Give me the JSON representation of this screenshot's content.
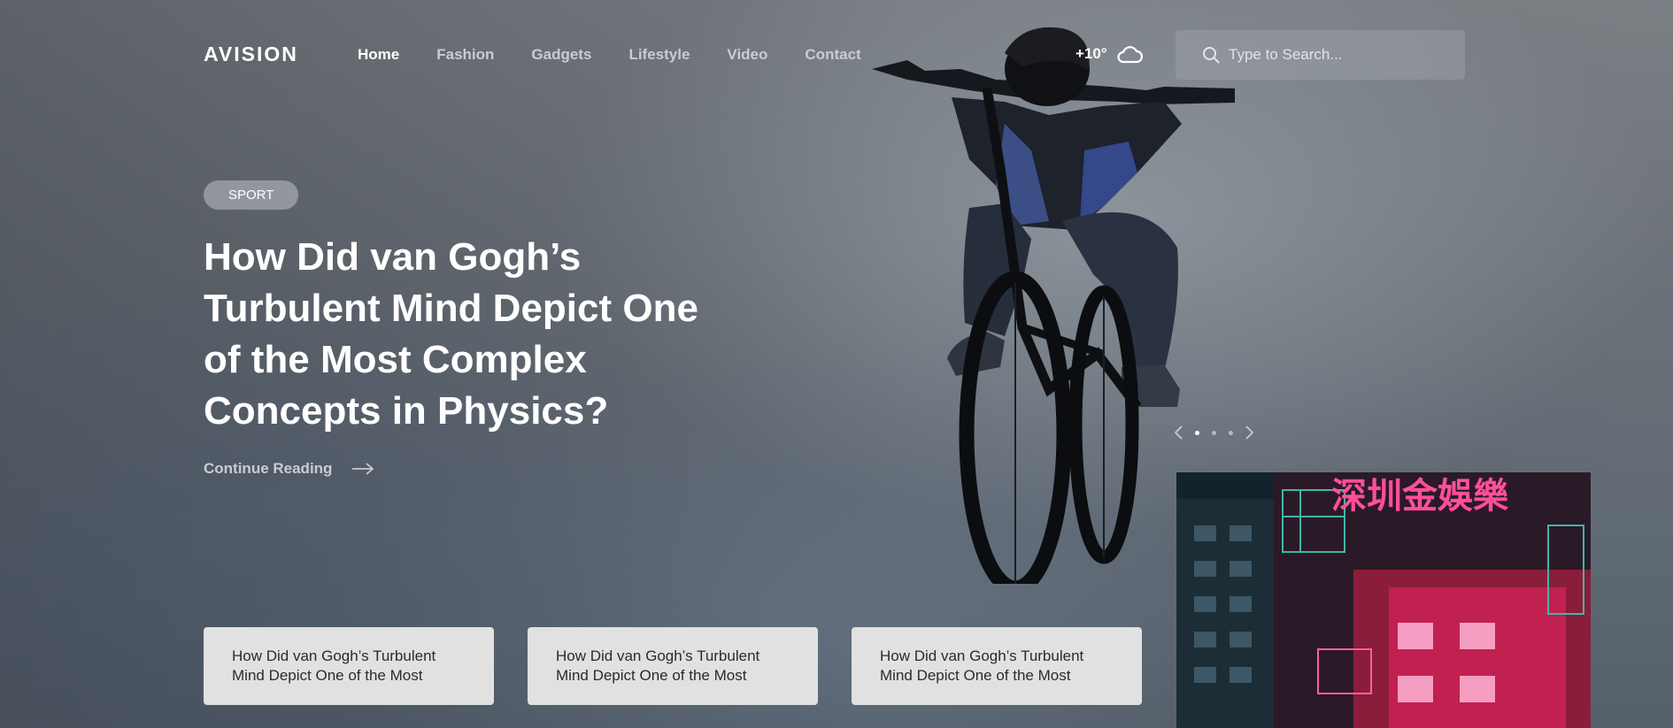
{
  "header": {
    "logo": "AVISION",
    "nav": [
      {
        "label": "Home",
        "active": true
      },
      {
        "label": "Fashion",
        "active": false
      },
      {
        "label": "Gadgets",
        "active": false
      },
      {
        "label": "Lifestyle",
        "active": false
      },
      {
        "label": "Video",
        "active": false
      },
      {
        "label": "Contact",
        "active": false
      }
    ],
    "weather": {
      "temperature": "+10°",
      "icon": "cloud-icon"
    },
    "search": {
      "placeholder": "Type to Search...",
      "value": ""
    }
  },
  "hero": {
    "category": "SPORT",
    "title": "How Did van Gogh’s Turbulent Mind Depict One of the Most Complex Concepts in Physics?",
    "continue_label": "Continue Reading",
    "slides": {
      "total": 3,
      "active_index": 0
    }
  },
  "cards": [
    {
      "title": "How Did van Gogh’s Turbulent Mind Depict One of the Most"
    },
    {
      "title": "How Did van Gogh’s Turbulent Mind Depict One of the Most"
    },
    {
      "title": "How Did van Gogh’s Turbulent Mind Depict One of the Most"
    }
  ],
  "side_image": {
    "neon_sign": "深圳金娛樂"
  },
  "colors": {
    "card_bg": "#e1e1e1",
    "nav_active": "#ffffff",
    "nav_inactive": "#c9ccd0"
  }
}
